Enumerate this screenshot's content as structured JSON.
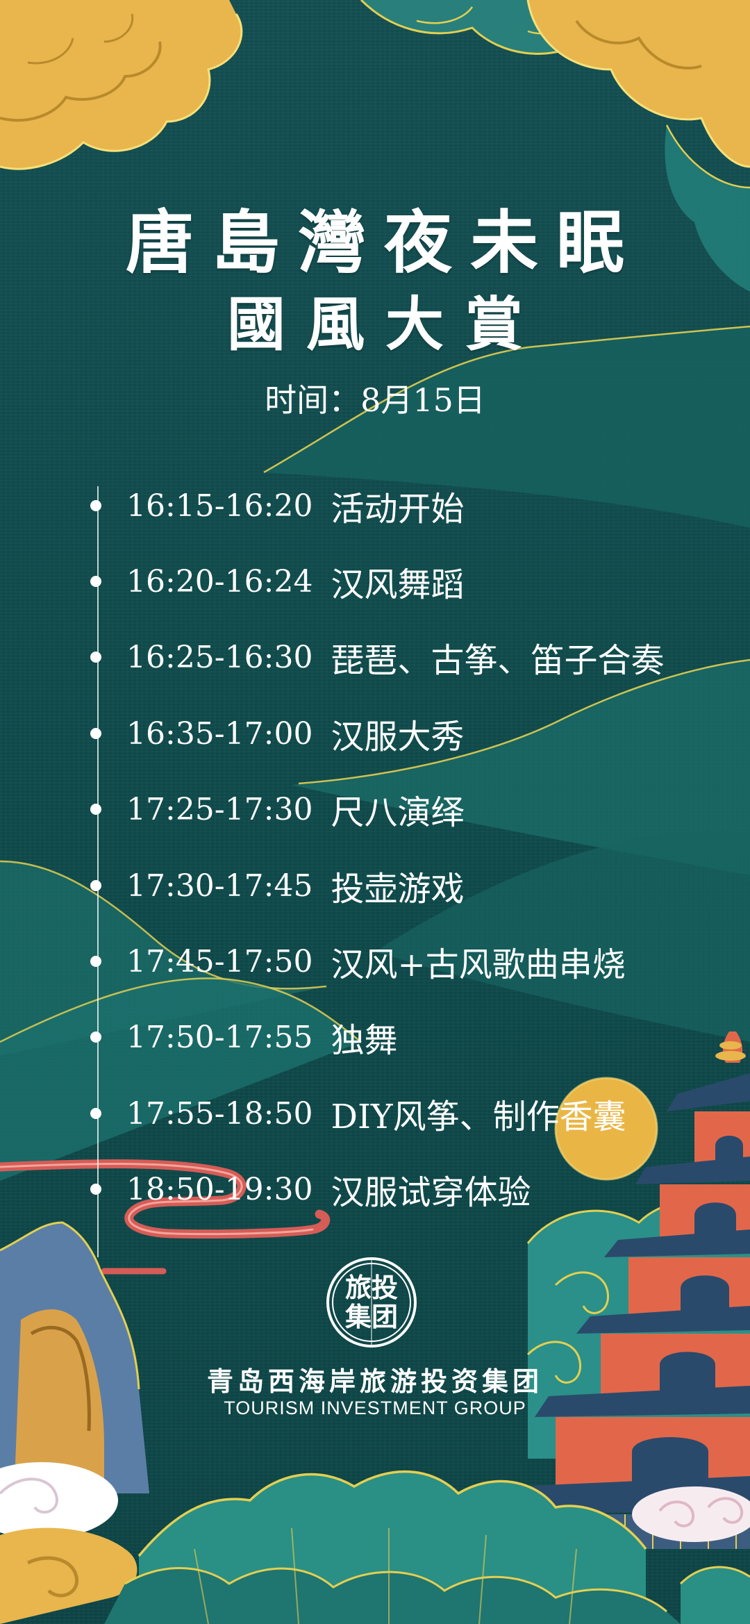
{
  "header": {
    "title": "唐島灣夜未眠",
    "subtitle": "國風大賞",
    "date": "时间：8月15日"
  },
  "schedule": [
    {
      "time": "16:15-16:20",
      "event": "活动开始"
    },
    {
      "time": "16:20-16:24",
      "event": "汉风舞蹈"
    },
    {
      "time": "16:25-16:30",
      "event": "琵琶、古筝、笛子合奏"
    },
    {
      "time": "16:35-17:00",
      "event": "汉服大秀"
    },
    {
      "time": "17:25-17:30",
      "event": "尺八演绎"
    },
    {
      "time": "17:30-17:45",
      "event": "投壶游戏"
    },
    {
      "time": "17:45-17:50",
      "event": "汉风+古风歌曲串烧"
    },
    {
      "time": "17:50-17:55",
      "event": "独舞"
    },
    {
      "time": "17:55-18:50",
      "event": "DIY风筝、制作香囊"
    },
    {
      "time": "18:50-19:30",
      "event": "汉服试穿体验"
    }
  ],
  "footer": {
    "logo_text": "旅投集团",
    "org_name": "青岛西海岸旅游投资集团",
    "org_english": "TOURISM INVESTMENT GROUP"
  },
  "colors": {
    "background": "#0f4e4f",
    "cloud_gold": "#e8b64c",
    "mountain_teal": "#1f7a77",
    "pagoda_red": "#e2674a",
    "moon": "#e9b646",
    "text": "#ffffff"
  }
}
